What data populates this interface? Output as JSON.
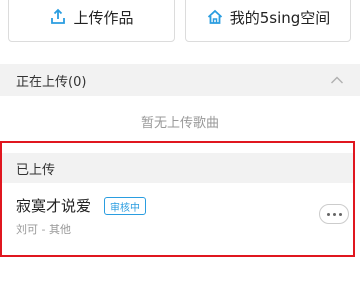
{
  "top_actions": {
    "upload_label": "上传作品",
    "space_label": "我的5sing空间",
    "upload_icon": "upload-icon",
    "space_icon": "home-icon",
    "accent": "#2a9de0"
  },
  "uploading": {
    "header": "正在上传(0)",
    "empty_text": "暂无上传歌曲",
    "collapse_icon": "chevron-up-icon"
  },
  "uploaded": {
    "header": "已上传",
    "songs": [
      {
        "title": "寂寞才说爱",
        "status": "审核中",
        "meta": "刘可 - 其他",
        "more_icon": "more-dots-icon"
      }
    ],
    "highlight_color": "#e0161f"
  }
}
